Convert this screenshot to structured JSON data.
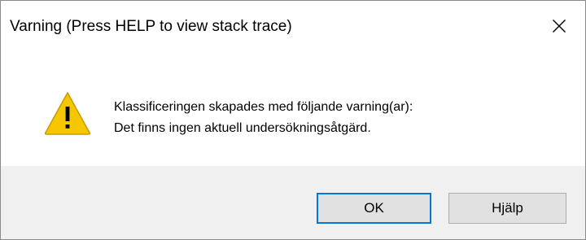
{
  "dialog": {
    "title": "Varning (Press HELP to view stack trace)",
    "close_icon": "close-icon"
  },
  "message": {
    "icon": "warning-icon",
    "line1": "Klassificeringen skapades med följande varning(ar):",
    "line2": "Det finns ingen aktuell undersökningsåtgärd."
  },
  "buttons": {
    "ok_label": "OK",
    "help_label": "Hjälp"
  },
  "colors": {
    "warning_yellow": "#f6c700",
    "focus_border": "#0078d7",
    "button_area_bg": "#f0f0f0",
    "button_bg": "#e1e1e1"
  }
}
